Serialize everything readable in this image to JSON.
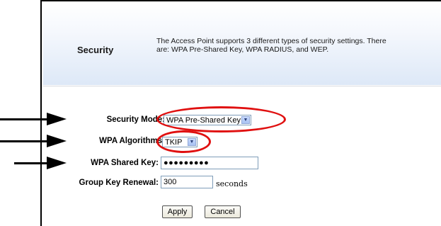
{
  "header": {
    "title": "Security",
    "description_line1": "The Access Point supports 3 different types of security settings. There",
    "description_line2": "are:  WPA Pre-Shared Key, WPA RADIUS, and WEP."
  },
  "form": {
    "security_mode_label": "Security Mode:",
    "security_mode_value": "WPA Pre-Shared Key",
    "wpa_algorithms_label": "WPA Algorithms:",
    "wpa_algorithms_value": "TKIP",
    "wpa_shared_key_label": "WPA Shared Key:",
    "wpa_shared_key_value": "●●●●●●●●●",
    "group_key_renewal_label": "Group Key Renewal:",
    "group_key_renewal_value": "300",
    "group_key_renewal_unit": "seconds"
  },
  "buttons": {
    "apply": "Apply",
    "cancel": "Cancel"
  },
  "annotations": {
    "highlight_color": "#e01010",
    "arrow_color": "#000000"
  }
}
